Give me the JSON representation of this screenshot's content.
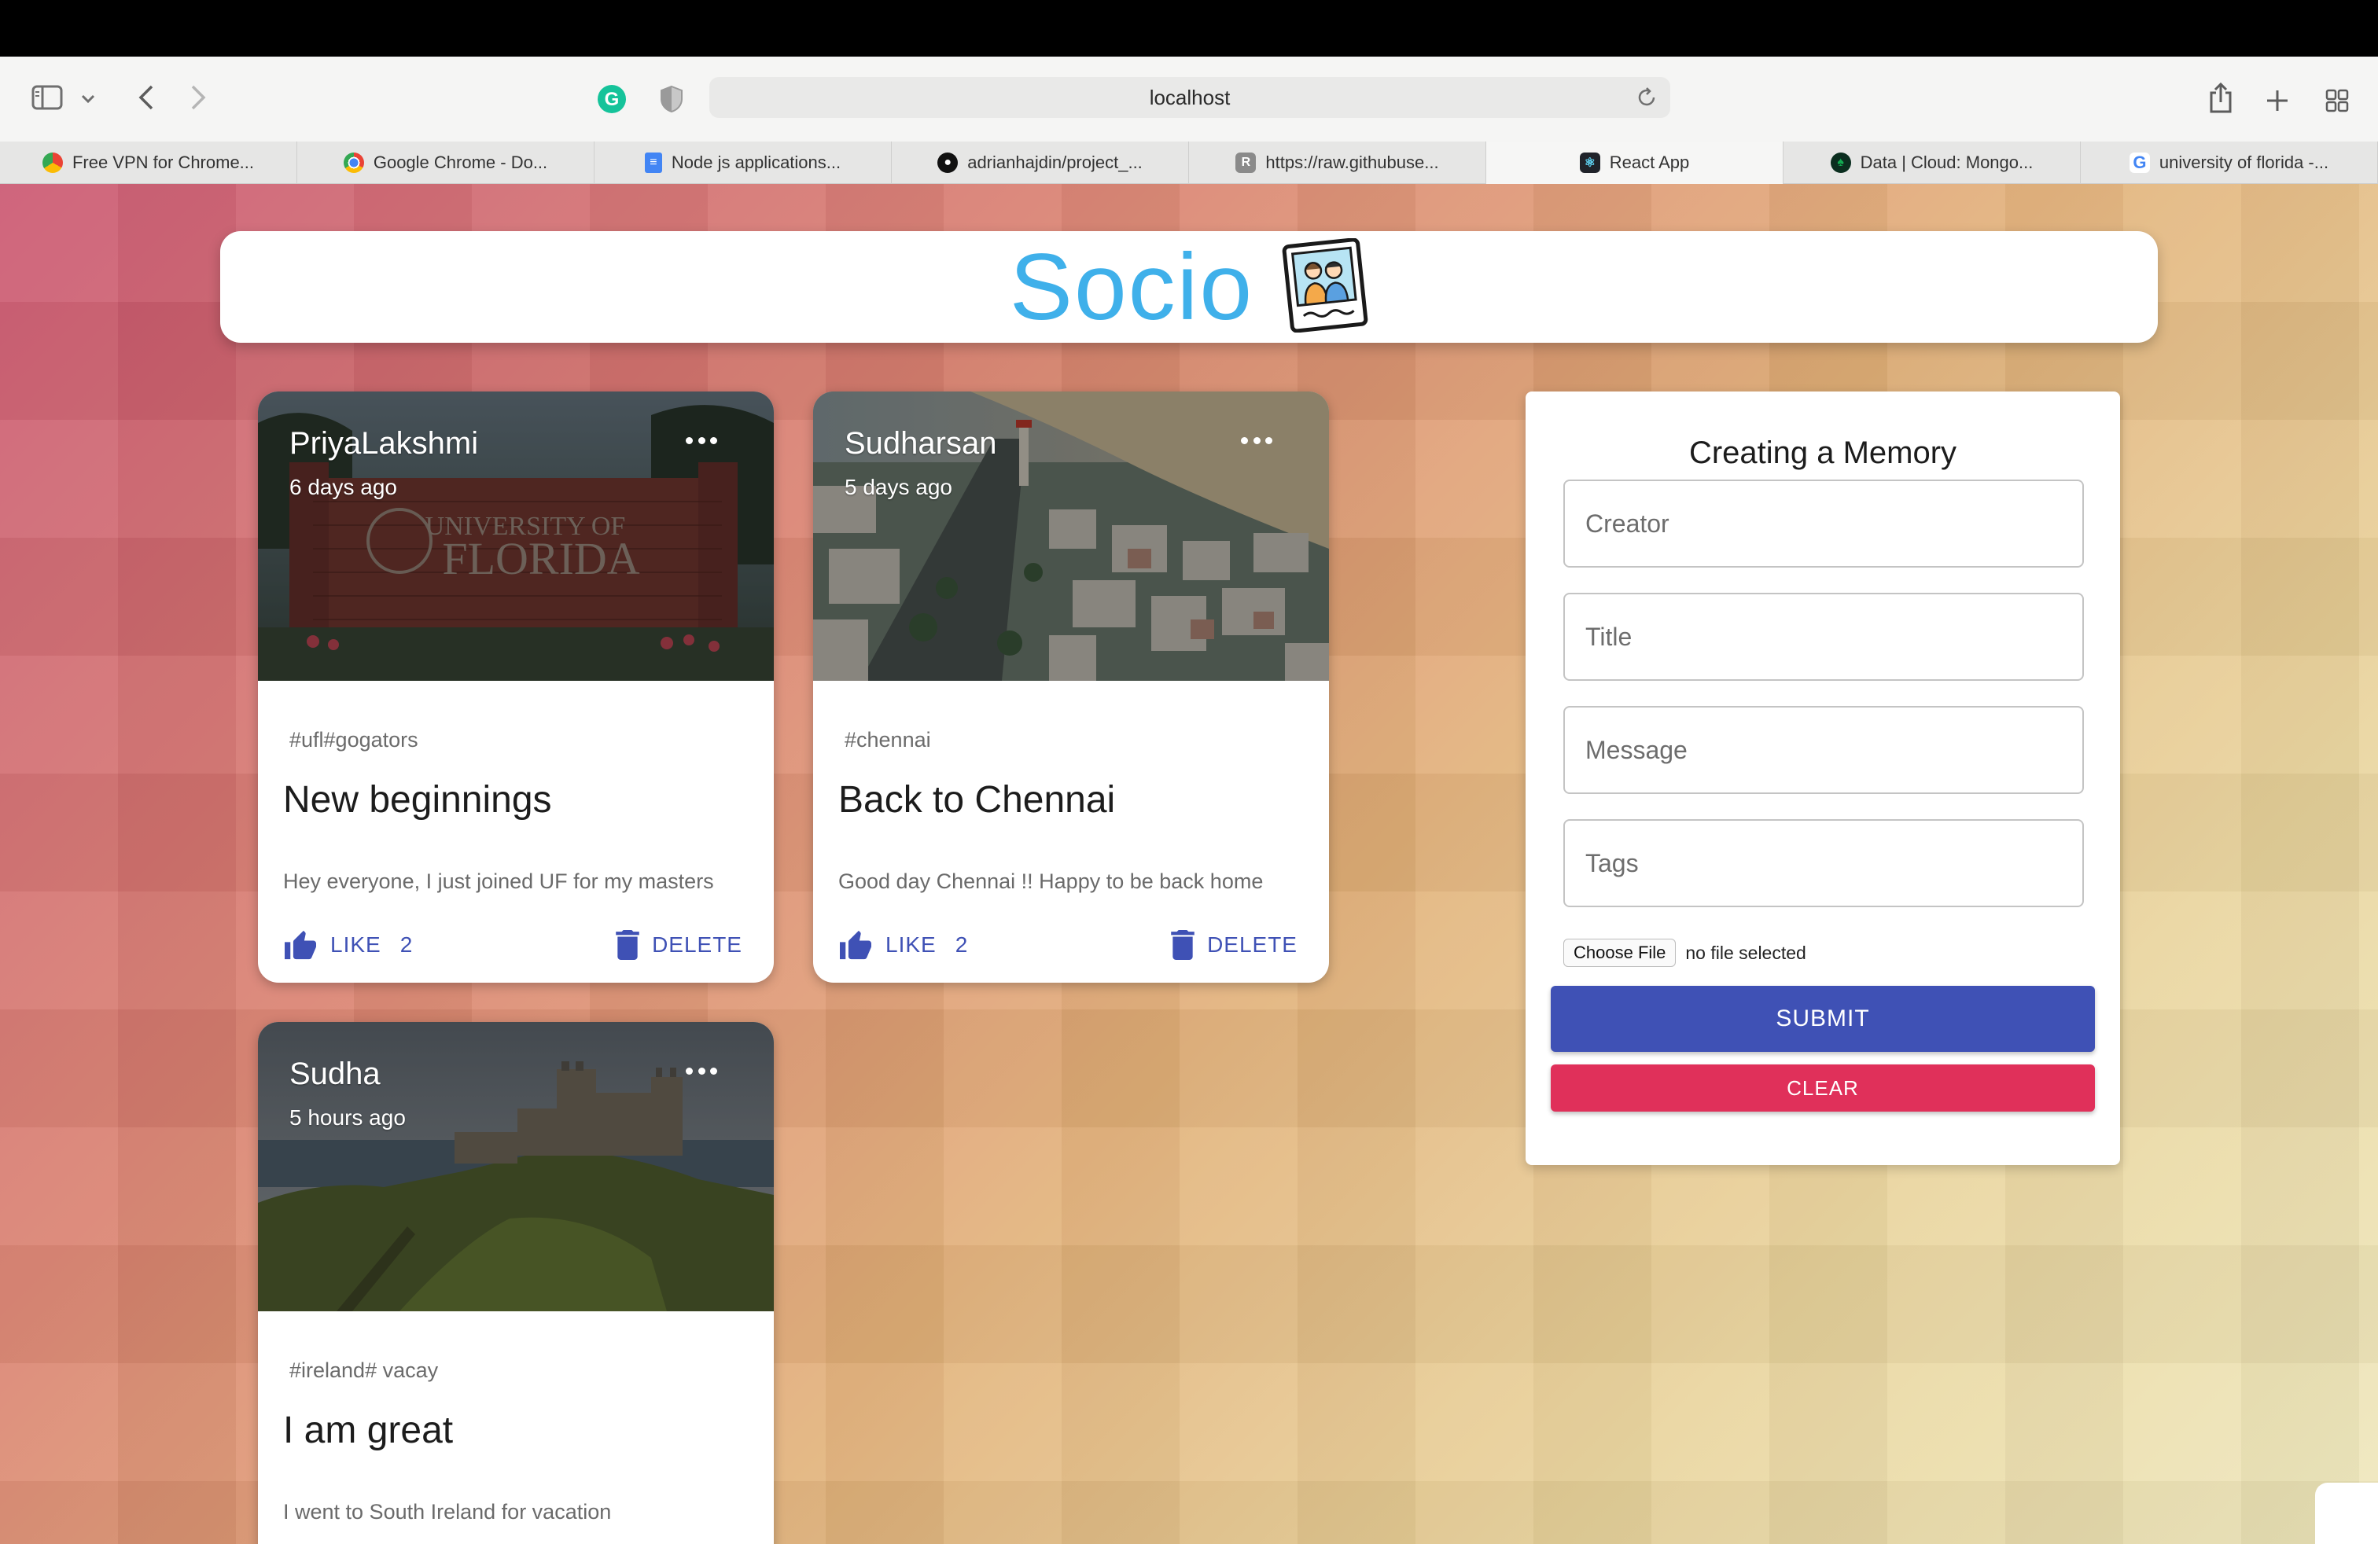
{
  "browser": {
    "url": "localhost",
    "tabs": [
      {
        "label": "Free VPN for Chrome...",
        "icon": "vpn-icon"
      },
      {
        "label": "Google Chrome - Do...",
        "icon": "chrome-icon"
      },
      {
        "label": "Node js applications...",
        "icon": "docs-icon"
      },
      {
        "label": "adrianhajdin/project_...",
        "icon": "github-icon"
      },
      {
        "label": "https://raw.githubuse...",
        "icon": "r-icon"
      },
      {
        "label": "React App",
        "icon": "react-icon",
        "active": true
      },
      {
        "label": "Data | Cloud: Mongo...",
        "icon": "mongodb-icon"
      },
      {
        "label": "university of florida -...",
        "icon": "google-icon"
      }
    ]
  },
  "app": {
    "title": "Socio",
    "logo": "photo-polaroid-icon",
    "brand_color": "#3fb0ea"
  },
  "posts": [
    {
      "creator": "PriyaLakshmi",
      "time": "6 days ago",
      "tags": "#ufl#gogators",
      "title": "New beginnings",
      "message": "Hey everyone, I just joined UF for my masters",
      "like_label": "LIKE",
      "likes": "2",
      "delete_label": "DELETE",
      "image_text_1": "UNIVERSITY OF",
      "image_text_2": "FLORIDA"
    },
    {
      "creator": "Sudharsan",
      "time": "5 days ago",
      "tags": "#chennai",
      "title": "Back to Chennai",
      "message": "Good day Chennai !! Happy to be back home",
      "like_label": "LIKE",
      "likes": "2",
      "delete_label": "DELETE"
    },
    {
      "creator": "Sudha",
      "time": "5 hours ago",
      "tags": "#ireland# vacay",
      "title": "I am great",
      "message": "I went to South Ireland for vacation"
    }
  ],
  "form": {
    "title": "Creating a Memory",
    "creator_placeholder": "Creator",
    "title_placeholder": "Title",
    "message_placeholder": "Message",
    "tags_placeholder": "Tags",
    "choose_file": "Choose File",
    "no_file": "no file selected",
    "submit": "SUBMIT",
    "clear": "CLEAR"
  },
  "colors": {
    "primary": "#3f51b5",
    "secondary": "#e0305a"
  }
}
